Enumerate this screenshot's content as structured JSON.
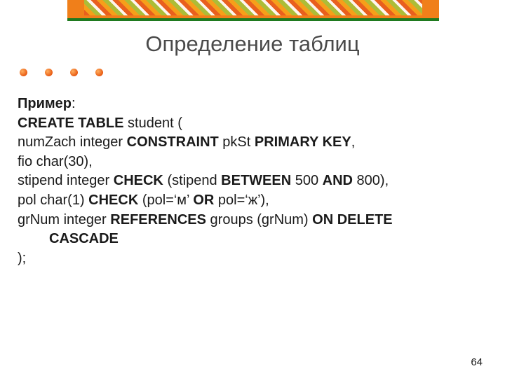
{
  "title": "Определение таблиц",
  "example_label": "Пример",
  "code": {
    "l1_kw": "CREATE TABLE",
    "l1_rest": " student (",
    "l2_a": "numZach integer ",
    "l2_kw1": "CONSTRAINT",
    "l2_b": " pkSt ",
    "l2_kw2": "PRIMARY KEY",
    "l2_c": ",",
    "l3": "fio char(30),",
    "l4_a": "stipend integer ",
    "l4_kw1": "CHECK",
    "l4_b": " (stipend ",
    "l4_kw2": "BETWEEN",
    "l4_c": " 500 ",
    "l4_kw3": "AND",
    "l4_d": " 800),",
    "l5_a": "pol char(1) ",
    "l5_kw1": "CHECK",
    "l5_b": " (pol=‘м’ ",
    "l5_kw2": "OR",
    "l5_c": " pol=‘ж’),",
    "l6_a": "grNum integer ",
    "l6_kw1": "REFERENCES",
    "l6_b": " groups (grNum) ",
    "l6_kw2": "ON DELETE",
    "l6_indent": "CASCADE",
    "l7": ");"
  },
  "page_number": "64"
}
